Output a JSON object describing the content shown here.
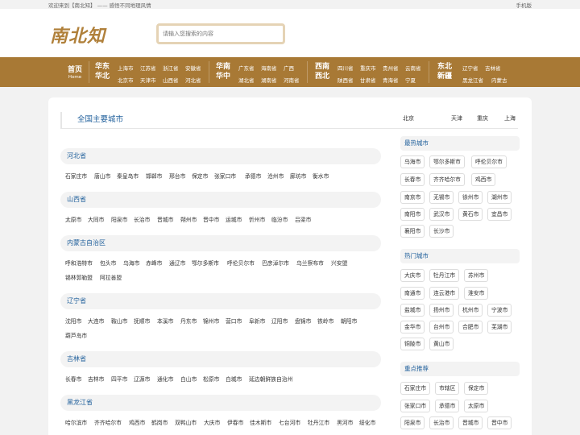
{
  "topbar": {
    "welcome": "欢迎来到【南北知】 —— 感悟不同地理风情",
    "mobile": "手机版"
  },
  "header": {
    "logo": "南北知",
    "search_placeholder": "请输入您搜索的内容"
  },
  "nav": {
    "home": {
      "label": "首页",
      "sub": "Home"
    },
    "regions": [
      {
        "name": [
          "华东",
          "华北"
        ],
        "cities": [
          "上海市",
          "江苏省",
          "浙江省",
          "安徽省",
          "北京市",
          "天津市",
          "山西省",
          "河北省"
        ]
      },
      {
        "name": [
          "华南",
          "华中"
        ],
        "cities": [
          "广东省",
          "海南省",
          "广西",
          "湖北省",
          "湖南省",
          "河南省"
        ]
      },
      {
        "name": [
          "西南",
          "西北"
        ],
        "cities": [
          "四川省",
          "重庆市",
          "贵州省",
          "云南省",
          "陕西省",
          "甘肃省",
          "青海省",
          "宁夏"
        ]
      },
      {
        "name": [
          "东北",
          "新疆"
        ],
        "cities": [
          "辽宁省",
          "吉林省",
          "黑龙江省",
          "内蒙古"
        ]
      }
    ]
  },
  "main": {
    "title": "全国主要城市",
    "quick_links": [
      "北京",
      "天津",
      "重庆",
      "上海"
    ],
    "provinces": [
      {
        "name": "河北省",
        "cities": [
          "石家庄市",
          "唐山市",
          "秦皇岛市",
          "邯郸市",
          "邢台市",
          "保定市",
          "张家口市",
          "承德市",
          "沧州市",
          "廊坊市",
          "衡水市"
        ]
      },
      {
        "name": "山西省",
        "cities": [
          "太原市",
          "大同市",
          "阳泉市",
          "长治市",
          "晋城市",
          "朔州市",
          "晋中市",
          "运城市",
          "忻州市",
          "临汾市",
          "吕梁市"
        ]
      },
      {
        "name": "内蒙古自治区",
        "cities": [
          "呼和浩特市",
          "包头市",
          "乌海市",
          "赤峰市",
          "通辽市",
          "鄂尔多斯市",
          "呼伦贝尔市",
          "巴彦淖尔市",
          "乌兰察布市",
          "兴安盟",
          "锡林郭勒盟",
          "阿拉善盟"
        ]
      },
      {
        "name": "辽宁省",
        "cities": [
          "沈阳市",
          "大连市",
          "鞍山市",
          "抚顺市",
          "本溪市",
          "丹东市",
          "锦州市",
          "营口市",
          "阜新市",
          "辽阳市",
          "盘锦市",
          "铁岭市",
          "朝阳市",
          "葫芦岛市"
        ]
      },
      {
        "name": "吉林省",
        "cities": [
          "长春市",
          "吉林市",
          "四平市",
          "辽源市",
          "通化市",
          "白山市",
          "松原市",
          "白城市",
          "延边朝鲜族自治州"
        ]
      },
      {
        "name": "黑龙江省",
        "cities": [
          "哈尔滨市",
          "齐齐哈尔市",
          "鸡西市",
          "鹤岗市",
          "双鸭山市",
          "大庆市",
          "伊春市",
          "佳木斯市",
          "七台河市",
          "牡丹江市",
          "黑河市",
          "绥化市"
        ]
      }
    ]
  },
  "sidebar": {
    "sections": [
      {
        "title": "最热城市",
        "tags": [
          "乌海市",
          "鄂尔多斯市",
          "呼伦贝尔市",
          "长春市",
          "齐齐哈尔市",
          "鸡西市",
          "南京市",
          "无锡市",
          "徐州市",
          "湖州市",
          "南阳市",
          "武汉市",
          "黄石市",
          "宜昌市",
          "襄阳市",
          "长沙市"
        ]
      },
      {
        "title": "热门城市",
        "tags": [
          "大庆市",
          "牡丹江市",
          "苏州市",
          "南通市",
          "连云港市",
          "淮安市",
          "盐城市",
          "扬州市",
          "杭州市",
          "宁波市",
          "金华市",
          "台州市",
          "合肥市",
          "芜湖市",
          "铜陵市",
          "黄山市"
        ]
      },
      {
        "title": "重点推荐",
        "tags": [
          "石家庄市",
          "市辖区",
          "保定市",
          "张家口市",
          "承德市",
          "太原市",
          "阳泉市",
          "长治市",
          "晋城市",
          "晋中市"
        ]
      }
    ]
  }
}
